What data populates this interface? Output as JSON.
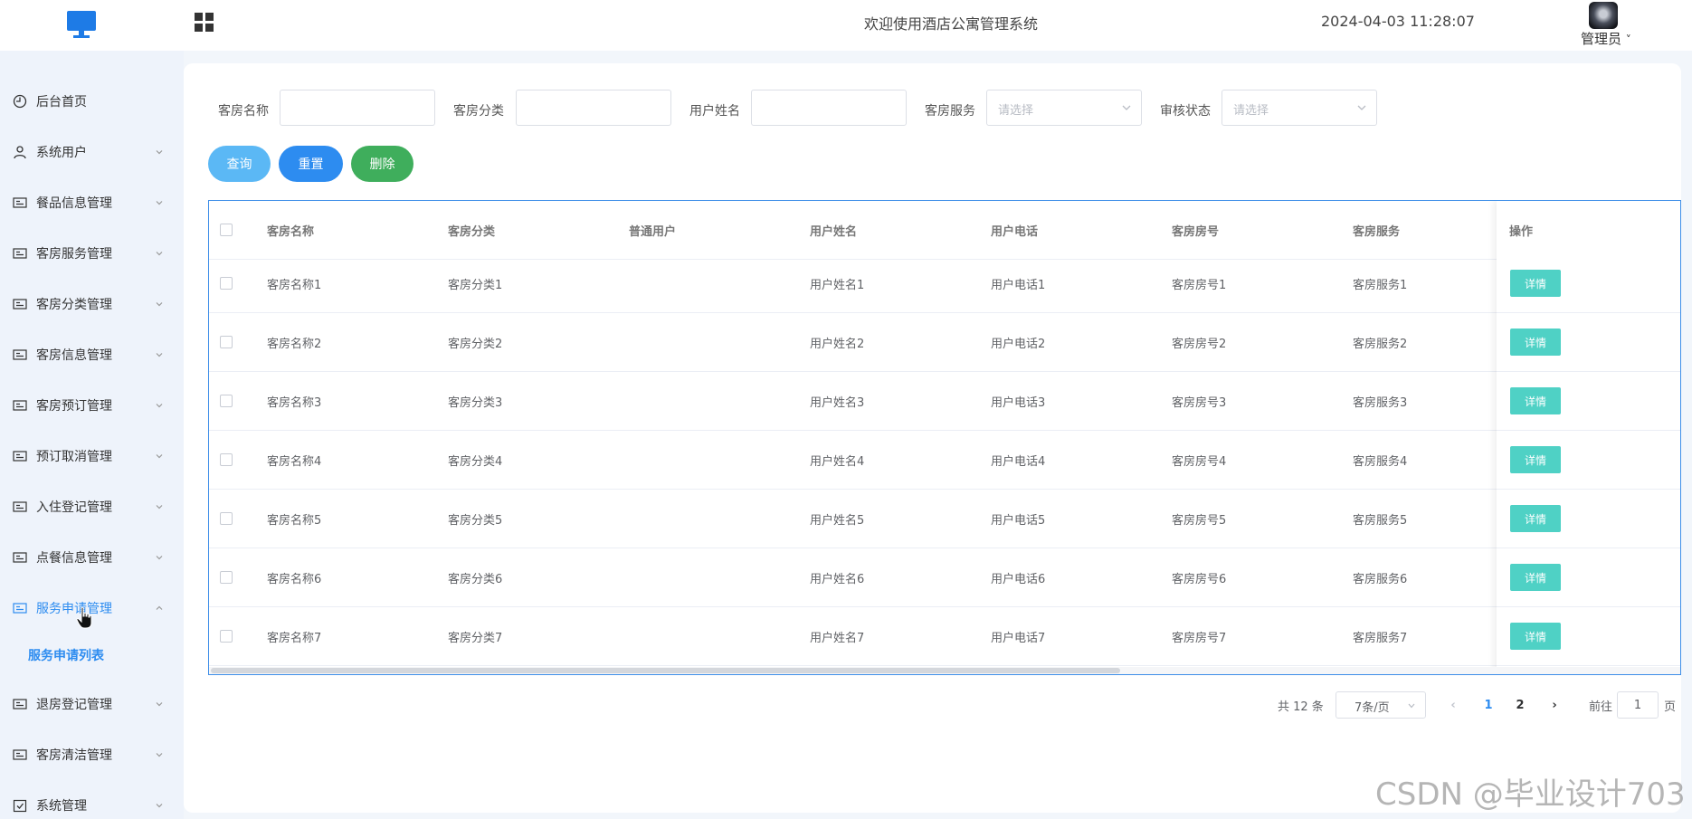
{
  "header": {
    "title": "欢迎使用酒店公寓管理系统",
    "datetime": "2024-04-03 11:28:07",
    "user": "管理员",
    "user_caret": "˅"
  },
  "sidebar": {
    "items": [
      {
        "label": "后台首页",
        "icon": "clock-icon"
      },
      {
        "label": "系统用户",
        "icon": "user-icon"
      },
      {
        "label": "餐品信息管理",
        "icon": "card-icon"
      },
      {
        "label": "客房服务管理",
        "icon": "card-icon"
      },
      {
        "label": "客房分类管理",
        "icon": "card-icon"
      },
      {
        "label": "客房信息管理",
        "icon": "card-icon"
      },
      {
        "label": "客房预订管理",
        "icon": "card-icon"
      },
      {
        "label": "预订取消管理",
        "icon": "card-icon"
      },
      {
        "label": "入住登记管理",
        "icon": "card-icon"
      },
      {
        "label": "点餐信息管理",
        "icon": "card-icon"
      },
      {
        "label": "服务申请管理",
        "icon": "card-icon",
        "active": true
      },
      {
        "label": "退房登记管理",
        "icon": "card-icon"
      },
      {
        "label": "客房清洁管理",
        "icon": "card-icon"
      },
      {
        "label": "系统管理",
        "icon": "checkbox-icon"
      }
    ],
    "sub_item": "服务申请列表",
    "accent": "#2d8cf0"
  },
  "filters": {
    "room_name_label": "客房名称",
    "room_name_value": "",
    "room_category_label": "客房分类",
    "room_category_value": "",
    "user_name_label": "用户姓名",
    "user_name_value": "",
    "room_service_label": "客房服务",
    "room_service_placeholder": "请选择",
    "review_status_label": "审核状态",
    "review_status_placeholder": "请选择"
  },
  "buttons": {
    "query": "查询",
    "reset": "重置",
    "delete": "删除",
    "query_color": "#5bb8f5",
    "reset_color": "#2d8cf0",
    "delete_color": "#3fae5c"
  },
  "table": {
    "columns": [
      "客房名称",
      "客房分类",
      "普通用户",
      "用户姓名",
      "用户电话",
      "客房房号",
      "客房服务",
      "操作"
    ],
    "rows": [
      [
        "客房名称1",
        "客房分类1",
        "",
        "用户姓名1",
        "用户电话1",
        "客房房号1",
        "客房服务1"
      ],
      [
        "客房名称2",
        "客房分类2",
        "",
        "用户姓名2",
        "用户电话2",
        "客房房号2",
        "客房服务2"
      ],
      [
        "客房名称3",
        "客房分类3",
        "",
        "用户姓名3",
        "用户电话3",
        "客房房号3",
        "客房服务3"
      ],
      [
        "客房名称4",
        "客房分类4",
        "",
        "用户姓名4",
        "用户电话4",
        "客房房号4",
        "客房服务4"
      ],
      [
        "客房名称5",
        "客房分类5",
        "",
        "用户姓名5",
        "用户电话5",
        "客房房号5",
        "客房服务5"
      ],
      [
        "客房名称6",
        "客房分类6",
        "",
        "用户姓名6",
        "用户电话6",
        "客房房号6",
        "客房服务6"
      ],
      [
        "客房名称7",
        "客房分类7",
        "",
        "用户姓名7",
        "用户电话7",
        "客房房号7",
        "客房服务7"
      ]
    ],
    "detail_label": "详情",
    "detail_color": "#4fd1c5"
  },
  "pagination": {
    "total": "共 12 条",
    "page_size": "7条/页",
    "pages": [
      "1",
      "2"
    ],
    "current_page": "1",
    "goto_prefix": "前往",
    "goto_value": "1",
    "goto_suffix": "页",
    "prev": "‹",
    "next": "›"
  },
  "watermark": "CSDN @毕业设计703"
}
